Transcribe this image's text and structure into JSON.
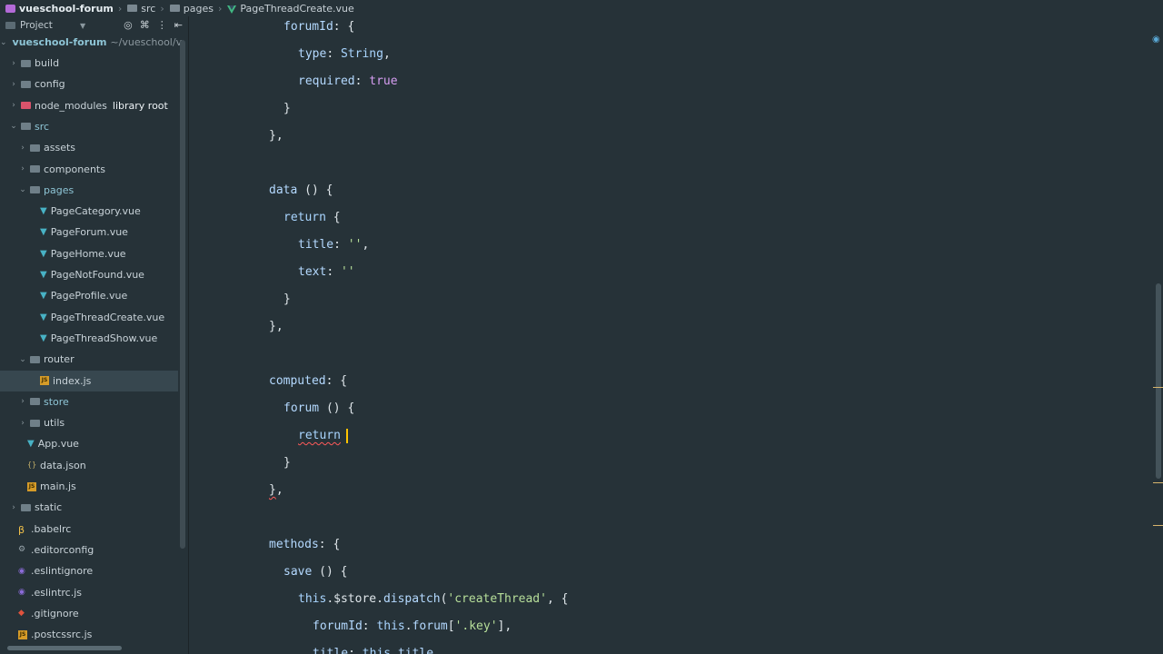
{
  "breadcrumb": {
    "project": "vueschool-forum",
    "items": [
      "src",
      "pages",
      "PageThreadCreate.vue"
    ]
  },
  "sidebar": {
    "header_label": "Project",
    "root": {
      "name": "vueschool-forum",
      "path": "~/vueschool/v"
    },
    "tree": [
      {
        "label": "build",
        "depth": 1,
        "kind": "folder",
        "expanded": false
      },
      {
        "label": "config",
        "depth": 1,
        "kind": "folder",
        "expanded": false
      },
      {
        "label": "node_modules",
        "suffix": "library root",
        "depth": 1,
        "kind": "folder-red",
        "expanded": false
      },
      {
        "label": "src",
        "depth": 1,
        "kind": "folder",
        "expanded": true
      },
      {
        "label": "assets",
        "depth": 2,
        "kind": "folder",
        "expanded": false
      },
      {
        "label": "components",
        "depth": 2,
        "kind": "folder",
        "expanded": false
      },
      {
        "label": "pages",
        "depth": 2,
        "kind": "folder",
        "expanded": true
      },
      {
        "label": "PageCategory.vue",
        "depth": 3,
        "kind": "vue"
      },
      {
        "label": "PageForum.vue",
        "depth": 3,
        "kind": "vue"
      },
      {
        "label": "PageHome.vue",
        "depth": 3,
        "kind": "vue"
      },
      {
        "label": "PageNotFound.vue",
        "depth": 3,
        "kind": "vue"
      },
      {
        "label": "PageProfile.vue",
        "depth": 3,
        "kind": "vue"
      },
      {
        "label": "PageThreadCreate.vue",
        "depth": 3,
        "kind": "vue"
      },
      {
        "label": "PageThreadShow.vue",
        "depth": 3,
        "kind": "vue"
      },
      {
        "label": "router",
        "depth": 2,
        "kind": "folder",
        "expanded": true
      },
      {
        "label": "index.js",
        "depth": 3,
        "kind": "js",
        "selected": true
      },
      {
        "label": "store",
        "depth": 2,
        "kind": "folder",
        "expanded": false
      },
      {
        "label": "utils",
        "depth": 2,
        "kind": "folder",
        "expanded": false
      },
      {
        "label": "App.vue",
        "depth": 2,
        "kind": "vue"
      },
      {
        "label": "data.json",
        "depth": 2,
        "kind": "json"
      },
      {
        "label": "main.js",
        "depth": 2,
        "kind": "js"
      },
      {
        "label": "static",
        "depth": 1,
        "kind": "folder",
        "expanded": false
      },
      {
        "label": ".babelrc",
        "depth": 1,
        "kind": "babel"
      },
      {
        "label": ".editorconfig",
        "depth": 1,
        "kind": "config"
      },
      {
        "label": ".eslintignore",
        "depth": 1,
        "kind": "eslint"
      },
      {
        "label": ".eslintrc.js",
        "depth": 1,
        "kind": "eslint"
      },
      {
        "label": ".gitignore",
        "depth": 1,
        "kind": "git"
      },
      {
        "label": ".postcssrc.js",
        "depth": 1,
        "kind": "js"
      }
    ]
  },
  "editor": {
    "lines": [
      "forumId: {",
      "type: String,",
      "required: true",
      "}",
      "},",
      "",
      "data () {",
      "return {",
      "title: '',",
      "text: ''",
      "}",
      "},",
      "",
      "computed: {",
      "forum () {",
      "return",
      "}",
      "},",
      "",
      "methods: {",
      "save () {",
      "this.$store.dispatch('createThread', {",
      "forumId: this.forum['.key'],",
      "title: this.title,"
    ]
  },
  "colors": {
    "background": "#263238",
    "selected_row": "#37474f",
    "caret": "#ffc400"
  }
}
